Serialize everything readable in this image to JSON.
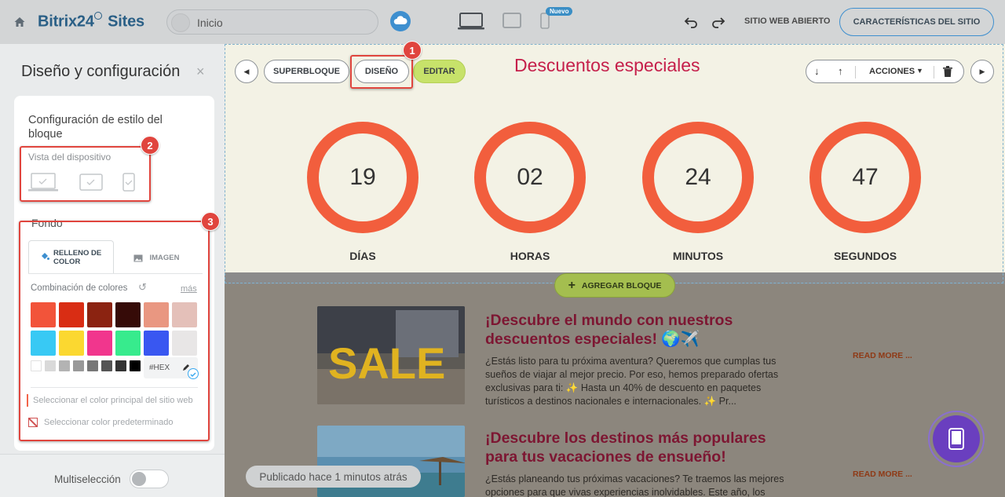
{
  "topbar": {
    "logo": "Bitrix24",
    "logo_suffix": "Sites",
    "page_selector": "Inicio",
    "new_badge": "Nuevo",
    "open_site": "SITIO WEB ABIERTO",
    "features_button": "CARACTERÍSTICAS DEL SITIO"
  },
  "sidebar": {
    "title": "Diseño y configuración",
    "close": "×",
    "style_title": "Configuración de estilo del bloque",
    "device_view_label": "Vista del dispositivo",
    "background_label": "Fondo",
    "tab_fill": "RELLENO DE COLOR",
    "tab_image": "IMAGEN",
    "color_combo_label": "Combinación de colores",
    "more_link": "más",
    "swatches": [
      "#f2543a",
      "#d92d14",
      "#8b2311",
      "#360b08",
      "#e99781",
      "#e4c0b9",
      "#38c9f4",
      "#fbd830",
      "#f1368d",
      "#37eb8d",
      "#3957f1",
      "#e8e6e6"
    ],
    "grays": [
      "#ffffff",
      "#d9d9d9",
      "#b3b3b3",
      "#999999",
      "#777777",
      "#555555",
      "#333333",
      "#000000"
    ],
    "hex_placeholder": "#HEX",
    "main_color": "Seleccionar el color principal del sitio web",
    "default_color": "Seleccionar color predeterminado",
    "multiselect_label": "Multiselección"
  },
  "annotations": {
    "n1": "1",
    "n2": "2",
    "n3": "3"
  },
  "block_toolbar": {
    "superblock": "SUPERBLOQUE",
    "design": "DISEÑO",
    "edit": "EDITAR",
    "actions": "ACCIONES"
  },
  "block": {
    "title": "Descuentos especiales",
    "timers": [
      {
        "value": "19",
        "label": "DÍAS"
      },
      {
        "value": "02",
        "label": "HORAS"
      },
      {
        "value": "24",
        "label": "MINUTOS"
      },
      {
        "value": "47",
        "label": "SEGUNDOS"
      }
    ]
  },
  "add_block": "AGREGAR BLOQUE",
  "articles": [
    {
      "title": "¡Descubre el mundo con nuestros descuentos especiales! 🌍✈️",
      "text": "¿Estás listo para tu próxima aventura? Queremos que cumplas tus sueños de viajar al mejor precio. Por eso, hemos preparado ofertas exclusivas para ti: ✨ Hasta un 40% de descuento en paquetes turísticos a destinos nacionales e internacionales. ✨ Pr...",
      "read_more": "READ MORE ...",
      "image_text": "SALE"
    },
    {
      "title": "¡Descubre los destinos más populares para tus vacaciones de ensueño!",
      "text": "¿Estás planeando tus próximas vacaciones? Te traemos las mejores opciones para que vivas experiencias inolvidables. Este año, los",
      "read_more": "READ MORE ..."
    }
  ],
  "status": "Publicado hace 1 minutos atrás",
  "colors": {
    "accent": "#f25e3d",
    "title": "#c51f4a",
    "annotation": "#e0453e",
    "fab": "#6a3fbf"
  }
}
